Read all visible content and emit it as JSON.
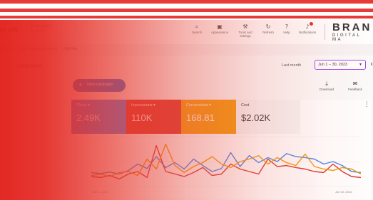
{
  "app": {
    "title": "ps ads",
    "account_line1": "A campaign 2",
    "account_line2": "ic ma C3"
  },
  "toolbar": {
    "search": "Search",
    "appearance": "Appearance",
    "tools_line1": "Tools and",
    "tools_line2": "settings",
    "refresh": "Refresh",
    "help": "Help",
    "notifications": "Notifications"
  },
  "brand": {
    "line1": "BRAN",
    "line2": "DIGITAL MA"
  },
  "breadcrumb": [
    "Enabled",
    "All programme Enabled",
    "Add filter"
  ],
  "overview": {
    "title": "Overview",
    "date_label": "Last month",
    "date_range": "Jun 1 – 30, 2023"
  },
  "actions": {
    "new_campaign": "New campaign",
    "download": "Download",
    "feedback": "Feedback"
  },
  "metrics": [
    {
      "name": "Clicks",
      "value": "2.49K",
      "color": "#4285f4"
    },
    {
      "name": "Impressions",
      "value": "110K",
      "color": "#d93025"
    },
    {
      "name": "Conversions",
      "value": "168.81",
      "color": "#f29900"
    },
    {
      "name": "Cost",
      "value": "$2.02K"
    }
  ],
  "chart_x_labels": {
    "start": "Jun 1, 2023",
    "end": "Jun 30, 2023"
  },
  "chart_data": {
    "type": "line",
    "x": [
      "Jun 1",
      "Jun 2",
      "Jun 3",
      "Jun 4",
      "Jun 5",
      "Jun 6",
      "Jun 7",
      "Jun 8",
      "Jun 9",
      "Jun 10",
      "Jun 11",
      "Jun 12",
      "Jun 13",
      "Jun 14",
      "Jun 15",
      "Jun 16",
      "Jun 17",
      "Jun 18",
      "Jun 19",
      "Jun 20",
      "Jun 21",
      "Jun 22",
      "Jun 23",
      "Jun 24",
      "Jun 25",
      "Jun 26",
      "Jun 27",
      "Jun 28",
      "Jun 29",
      "Jun 30"
    ],
    "series": [
      {
        "name": "Clicks",
        "color": "#4285f4",
        "values": [
          28,
          26,
          29,
          25,
          32,
          45,
          36,
          60,
          38,
          48,
          35,
          55,
          42,
          30,
          36,
          68,
          40,
          62,
          48,
          58,
          50,
          66,
          60,
          58,
          55,
          45,
          50,
          42,
          30,
          28
        ]
      },
      {
        "name": "Impressions",
        "color": "#d93025",
        "values": [
          20,
          18,
          22,
          15,
          25,
          30,
          18,
          82,
          30,
          25,
          20,
          28,
          38,
          22,
          25,
          45,
          35,
          30,
          25,
          55,
          40,
          42,
          38,
          35,
          30,
          28,
          45,
          30,
          20,
          18
        ]
      },
      {
        "name": "Conversions",
        "color": "#f29900",
        "values": [
          22,
          25,
          20,
          28,
          30,
          22,
          55,
          35,
          85,
          42,
          28,
          40,
          48,
          60,
          45,
          38,
          50,
          55,
          62,
          45,
          58,
          48,
          42,
          65,
          40,
          35,
          32,
          38,
          35,
          25
        ]
      }
    ],
    "ylim": [
      0,
      100
    ]
  },
  "colors": {
    "overlay": "#e2221c",
    "accent": "#a142f4",
    "primary": "#1a73e8"
  }
}
